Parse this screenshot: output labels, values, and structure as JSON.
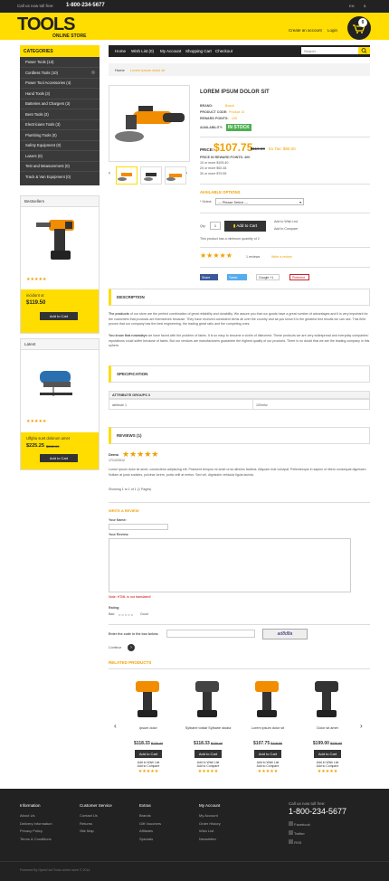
{
  "topbar": {
    "call_label": "Call us now toll free:",
    "phone": "1-800-234-5677",
    "lang": "EN",
    "currency": "$"
  },
  "header": {
    "logo_main": "TOOLS",
    "logo_sub": "ONLINE STORE",
    "create_account": "Create an account",
    "login": "Login",
    "cart_count": "0"
  },
  "nav": {
    "items": [
      "Home",
      "Wish List (0)",
      "My Account",
      "Shopping Cart",
      "Checkout"
    ],
    "search_placeholder": "Search"
  },
  "categories": {
    "title": "CATEGORIES",
    "items": [
      "Power Tools (13)",
      "Cordless Tools (10)",
      "Power Tool Accessories (4)",
      "Hand Tools (3)",
      "Batteries and Chargers (3)",
      "Bent Tools (3)",
      "Electricians Tools (3)",
      "Plumbing Tools (0)",
      "Safety Equipment (0)",
      "Lasers (0)",
      "Test and Measurement (0)",
      "Track & Van Equipment (0)"
    ]
  },
  "bestsellers": {
    "title": "Bestsellers",
    "product_name": "incidunt ut",
    "price": "$119.50",
    "add_to_cart": "Add to Cart"
  },
  "latest": {
    "title": "Latest",
    "product_name": "Ulfgha sunt dolorum amet",
    "price_new": "$225.25",
    "price_old": "$280.00",
    "add_to_cart": "Add to Cart"
  },
  "breadcrumb": {
    "home": "Home",
    "current": "Lorem ipsum dolor sit"
  },
  "product": {
    "title": "LOREM IPSUM DOLOR SIT",
    "brand_label": "BRAND:",
    "brand": "Bosch",
    "code_label": "PRODUCT CODE:",
    "code": "Product 14",
    "reward_label": "REWARD POINTS:",
    "reward": "100",
    "avail_label": "AVAILABILITY:",
    "avail": "IN STOCK",
    "price_label": "PRICE:",
    "price": "$107.75",
    "price_old": "$119.50",
    "ex_tax": "Ex Tax: $90.00",
    "discount_label": "PRICE IN REWARD POINTS: 400",
    "discounts": [
      "10 or more $105.40",
      "20 or more $92.48",
      "30 or more $79.55"
    ],
    "options_title": "AVAILABLE OPTIONS",
    "select_label": "* Select:",
    "select_value": " --- Please Select --- ",
    "qty_label": "Qty:",
    "qty": "1",
    "add_to_cart": "Add to Cart",
    "add_wishlist": "Add to Wish List",
    "add_compare": "Add to Compare",
    "min_qty": "This product has a minimum quantity of 2",
    "reviews_count": "1 reviews",
    "write_review": "Write a review",
    "share": [
      "Share",
      "Tweet",
      "Google +1",
      "Pinterest"
    ]
  },
  "description": {
    "tab": "DESCRIPTION",
    "p1_bold": "The products",
    "p1": " of our store are the perfect combination of great reliability and durability. We assure you that our goods have a great number of advantages and it is very important for the customers that products are themselves because. They have received consistent items all over the country and as you know it is the greatest test results we can use. This field proves that our company has the best engineering, the trading great ratio and the competing ones.",
    "p2_bold": "You know that nowadays",
    "p2": " we have faced with the problem of fakes. It is so easy to become a victim of dishonest. These products we are very widespread and everyday companies' reputations could suffer because of fakes. But our vendors are manufacturers guarantee the highest quality of our products. There is no doubt that we are the leading company in this sphere."
  },
  "specification": {
    "tab": "SPECIFICATION",
    "group": "ATTRIBUTE GROUPS 3",
    "attr": "attribute 1",
    "value": "100mhz"
  },
  "reviews": {
    "tab": "REVIEWS (1)",
    "author": "Demo",
    "date": "17/12/2012",
    "text": "Lorem ipsum dolor sit amet, consectetur adipiscing elit. Praesent tempus mi amet urna ultricies facilisis. Aliquam erat volutpat. Pellentesque in sapien ut libero consequat dignissim. Nullam at justo sodales, pulvinar lorem, porta velit at metus. Sed vel, dignissim vehicula ligula lacinia.",
    "showing": "Showing 1 to 1 of 1 (1 Pages)",
    "write_title": "WRITE A REVIEW",
    "name_label": "Your Name:",
    "review_label": "Your Review:",
    "note": "Note: HTML is not translated!",
    "rating_label": "Rating:",
    "bad": "Bad",
    "good": "Good",
    "captcha_label": "Enter the code in the box below:",
    "captcha_code": "ad8d8a",
    "continue": "Continue"
  },
  "related": {
    "title": "RELATED PRODUCTS",
    "items": [
      {
        "name": "ipsum dolor",
        "price": "$118.33",
        "old": "$120.44",
        "cart": "Add to Cart",
        "wish": "Add to Wish List",
        "compare": "Add to Compare"
      },
      {
        "name": "Sylbarie totdar Sylbarie stodia",
        "price": "$118.33",
        "old": "$130.44",
        "cart": "Add to Cart",
        "wish": "Add to Wish List",
        "compare": "Add to Compare"
      },
      {
        "name": "Lorem ipsum dolor sit",
        "price": "$107.75",
        "old": "$119.50",
        "cart": "Add to Cart",
        "wish": "Add to Wish List",
        "compare": "Add to Compare"
      },
      {
        "name": "Dolor sit amet",
        "price": "$199.00",
        "old": "$230.00",
        "cart": "Add to Cart",
        "wish": "Add to Wish List",
        "compare": "Add to Compare"
      }
    ]
  },
  "footer": {
    "info": {
      "title": "Information",
      "items": [
        "About Us",
        "Delivery Information",
        "Privacy Policy",
        "Terms & Conditions"
      ]
    },
    "service": {
      "title": "Customer Service",
      "items": [
        "Contact Us",
        "Returns",
        "Site Map"
      ]
    },
    "extras": {
      "title": "Extras",
      "items": [
        "Brands",
        "Gift Vouchers",
        "Affiliates",
        "Specials"
      ]
    },
    "account": {
      "title": "My Account",
      "items": [
        "My Account",
        "Order History",
        "Wish List",
        "Newsletter"
      ]
    },
    "call_label": "Call us now toll free:",
    "phone": "1-800-234-5677",
    "social": [
      "Facebook",
      "Twitter",
      "RSS"
    ],
    "copyright": "Powered By OpenCart Tools online store © 2014"
  },
  "colors": {
    "accent": "#ffdd00",
    "dark": "#222222",
    "price": "#f0a000",
    "stock": "#4caf50"
  }
}
